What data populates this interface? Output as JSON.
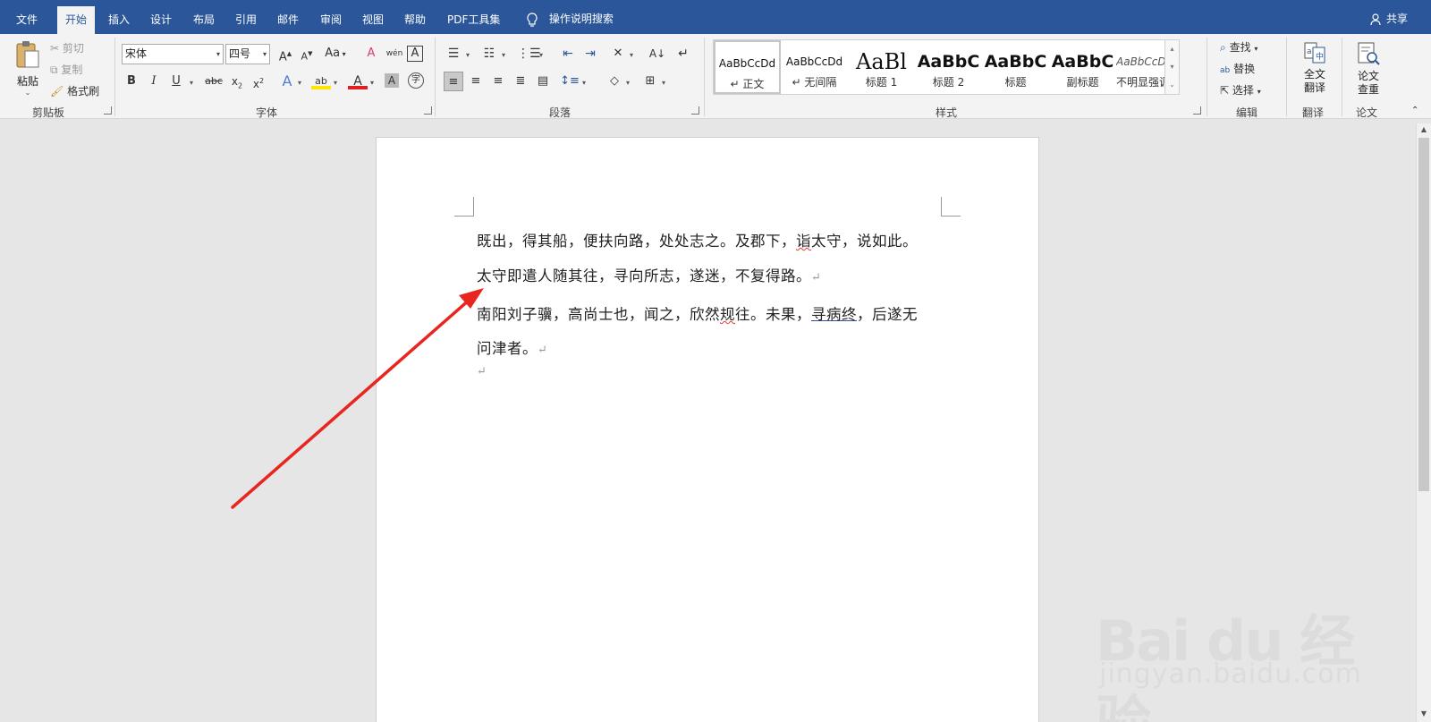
{
  "menubar": {
    "tabs": [
      "文件",
      "开始",
      "插入",
      "设计",
      "布局",
      "引用",
      "邮件",
      "审阅",
      "视图",
      "帮助",
      "PDF工具集"
    ],
    "active_tab": "开始",
    "tell_me": "操作说明搜索",
    "share": "共享"
  },
  "ribbon": {
    "clipboard": {
      "label": "剪贴板",
      "paste": "粘贴",
      "cut": "剪切",
      "copy": "复制",
      "format_painter": "格式刷"
    },
    "font": {
      "label": "字体",
      "font_name": "宋体",
      "font_size": "四号",
      "change_case": "Aa",
      "phonetic": "wén",
      "enclose": "A"
    },
    "paragraph": {
      "label": "段落"
    },
    "styles": {
      "label": "样式",
      "items": [
        {
          "preview": "AaBbCcDd",
          "name": "正文"
        },
        {
          "preview": "AaBbCcDd",
          "name": "无间隔"
        },
        {
          "preview": "AaBl",
          "name": "标题 1"
        },
        {
          "preview": "AaBbC",
          "name": "标题 2"
        },
        {
          "preview": "AaBbC",
          "name": "标题"
        },
        {
          "preview": "AaBbC",
          "name": "副标题"
        },
        {
          "preview": "AaBbCcDd",
          "name": "不明显强调"
        }
      ]
    },
    "editing": {
      "label": "编辑",
      "find": "查找",
      "replace": "替换",
      "select": "选择"
    },
    "translate": {
      "label": "翻译",
      "full_translate": "全文\n翻译",
      "full_translate_1": "全文",
      "full_translate_2": "翻译"
    },
    "paper": {
      "label": "论文",
      "check_1": "论文",
      "check_2": "查重"
    }
  },
  "document": {
    "para1_line1_a": "既出，得其船，便扶向路，处处志之。及郡下，",
    "para1_line1_b": "诣",
    "para1_line1_c": "太守，说如此。",
    "para1_line2": "太守即遣人随其往，寻向所志，遂迷，不复得路。",
    "para2_line1_a": "南阳刘子骥，高尚士也，闻之，欣然",
    "para2_line1_b": "规",
    "para2_line1_c": "往。未果，",
    "para2_line1_d": "寻病终",
    "para2_line1_e": "，后遂无",
    "para2_line2": "问津者。",
    "para_mark": "↵"
  },
  "watermark": {
    "brand": "Bai du 经验",
    "url": "jingyan.baidu.com"
  },
  "colors": {
    "accent": "#2b579a",
    "arrow": "#e8261f",
    "ribbon_bg": "#f3f3f3",
    "canvas_bg": "#e6e6e6"
  }
}
